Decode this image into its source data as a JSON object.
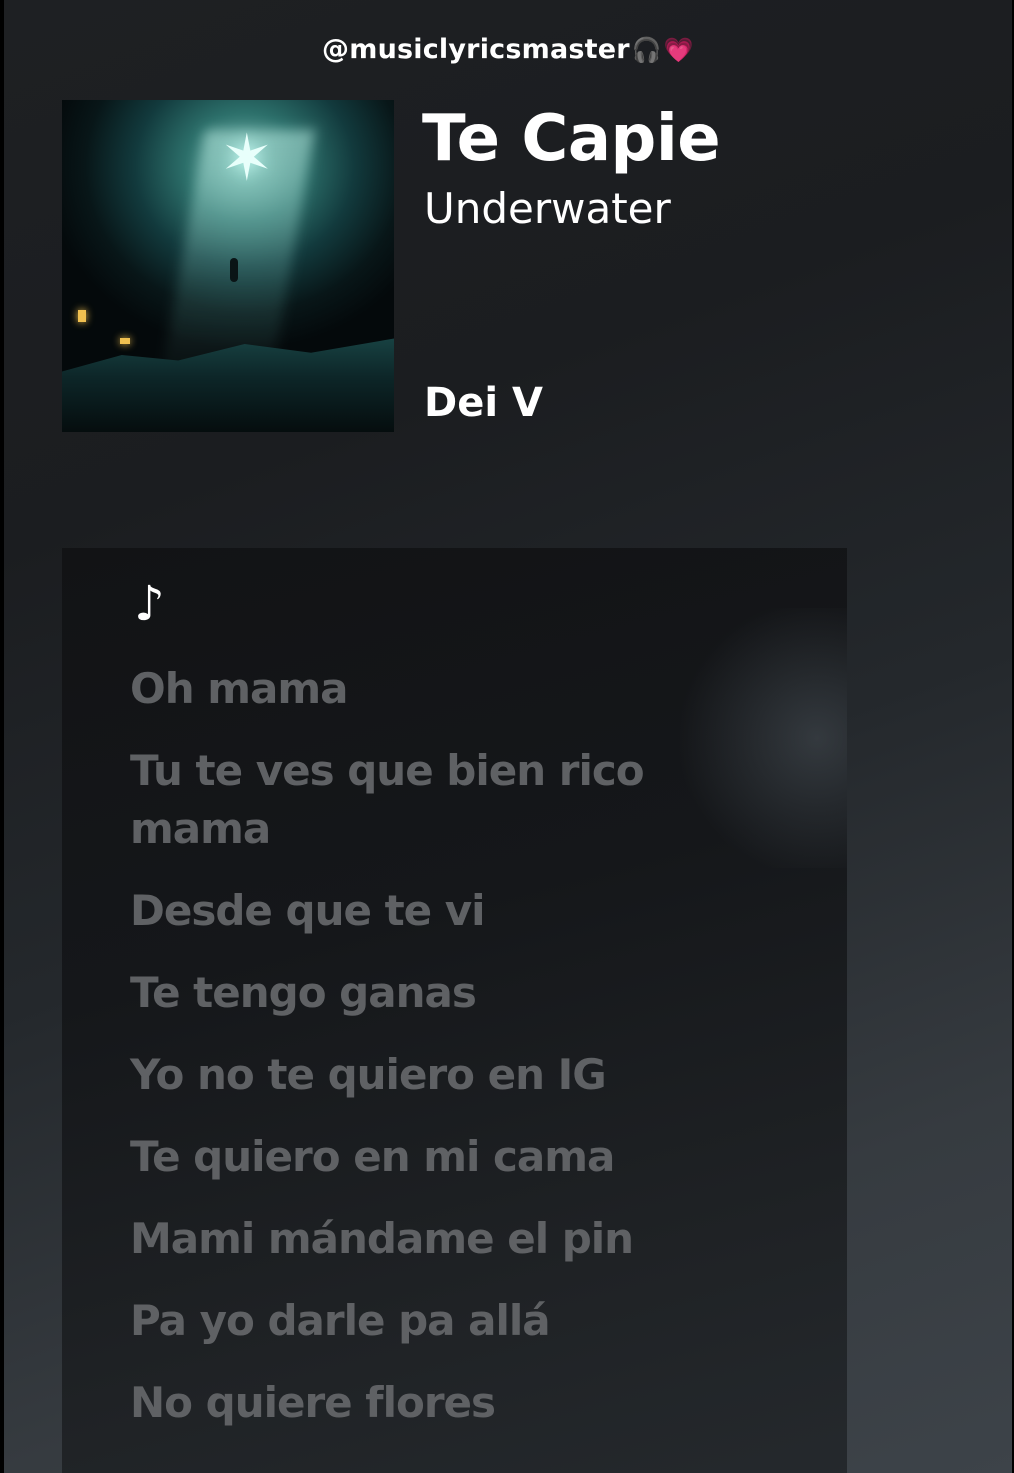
{
  "watermark": {
    "handle": "@musiclyricsmaster",
    "emoji_headphones": "🎧",
    "emoji_heart": "💗"
  },
  "track": {
    "title": "Te Capie",
    "album": "Underwater",
    "artist": "Dei V"
  },
  "lyrics": {
    "note_symbol": "♪",
    "lines": [
      "Oh mama",
      "Tu te ves que bien rico mama",
      "Desde que te vi",
      "Te tengo ganas",
      "Yo no te quiero en IG",
      "Te quiero en mi cama",
      "Mami mándame el pin",
      "Pa yo darle pa allá",
      "No quiere flores"
    ]
  },
  "colors": {
    "lyric_inactive": "#5f6164",
    "text_primary": "#ffffff",
    "heart": "#ff3d9a"
  }
}
